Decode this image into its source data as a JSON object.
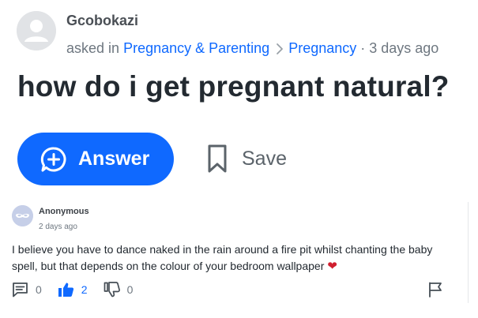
{
  "question": {
    "asker_name": "Gcobokazi",
    "asked_in_prefix": "asked in",
    "category": "Pregnancy & Parenting",
    "subcategory": "Pregnancy",
    "separator": "·",
    "time_ago": "3 days ago",
    "title": "how do i get pregnant natural?",
    "answer_button_label": "Answer",
    "save_button_label": "Save"
  },
  "answer": {
    "author": "Anonymous",
    "time_ago": "2 days ago",
    "body": "I believe you have to dance naked in the rain around a fire pit whilst chanting the baby spell, but that depends on the colour of your bedroom wallpaper",
    "emoji": "❤",
    "comments_count": "0",
    "likes_count": "2",
    "dislikes_count": "0"
  },
  "colors": {
    "accent": "#0f69ff",
    "text_primary": "#232a31",
    "text_secondary": "#6e7780",
    "heart": "#d01f2f"
  },
  "icons": [
    "user-avatar-icon",
    "chevron-right-icon",
    "plus-circle-icon",
    "bookmark-icon",
    "anonymous-mask-icon",
    "comment-icon",
    "thumbs-up-icon",
    "thumbs-down-icon",
    "flag-icon"
  ]
}
